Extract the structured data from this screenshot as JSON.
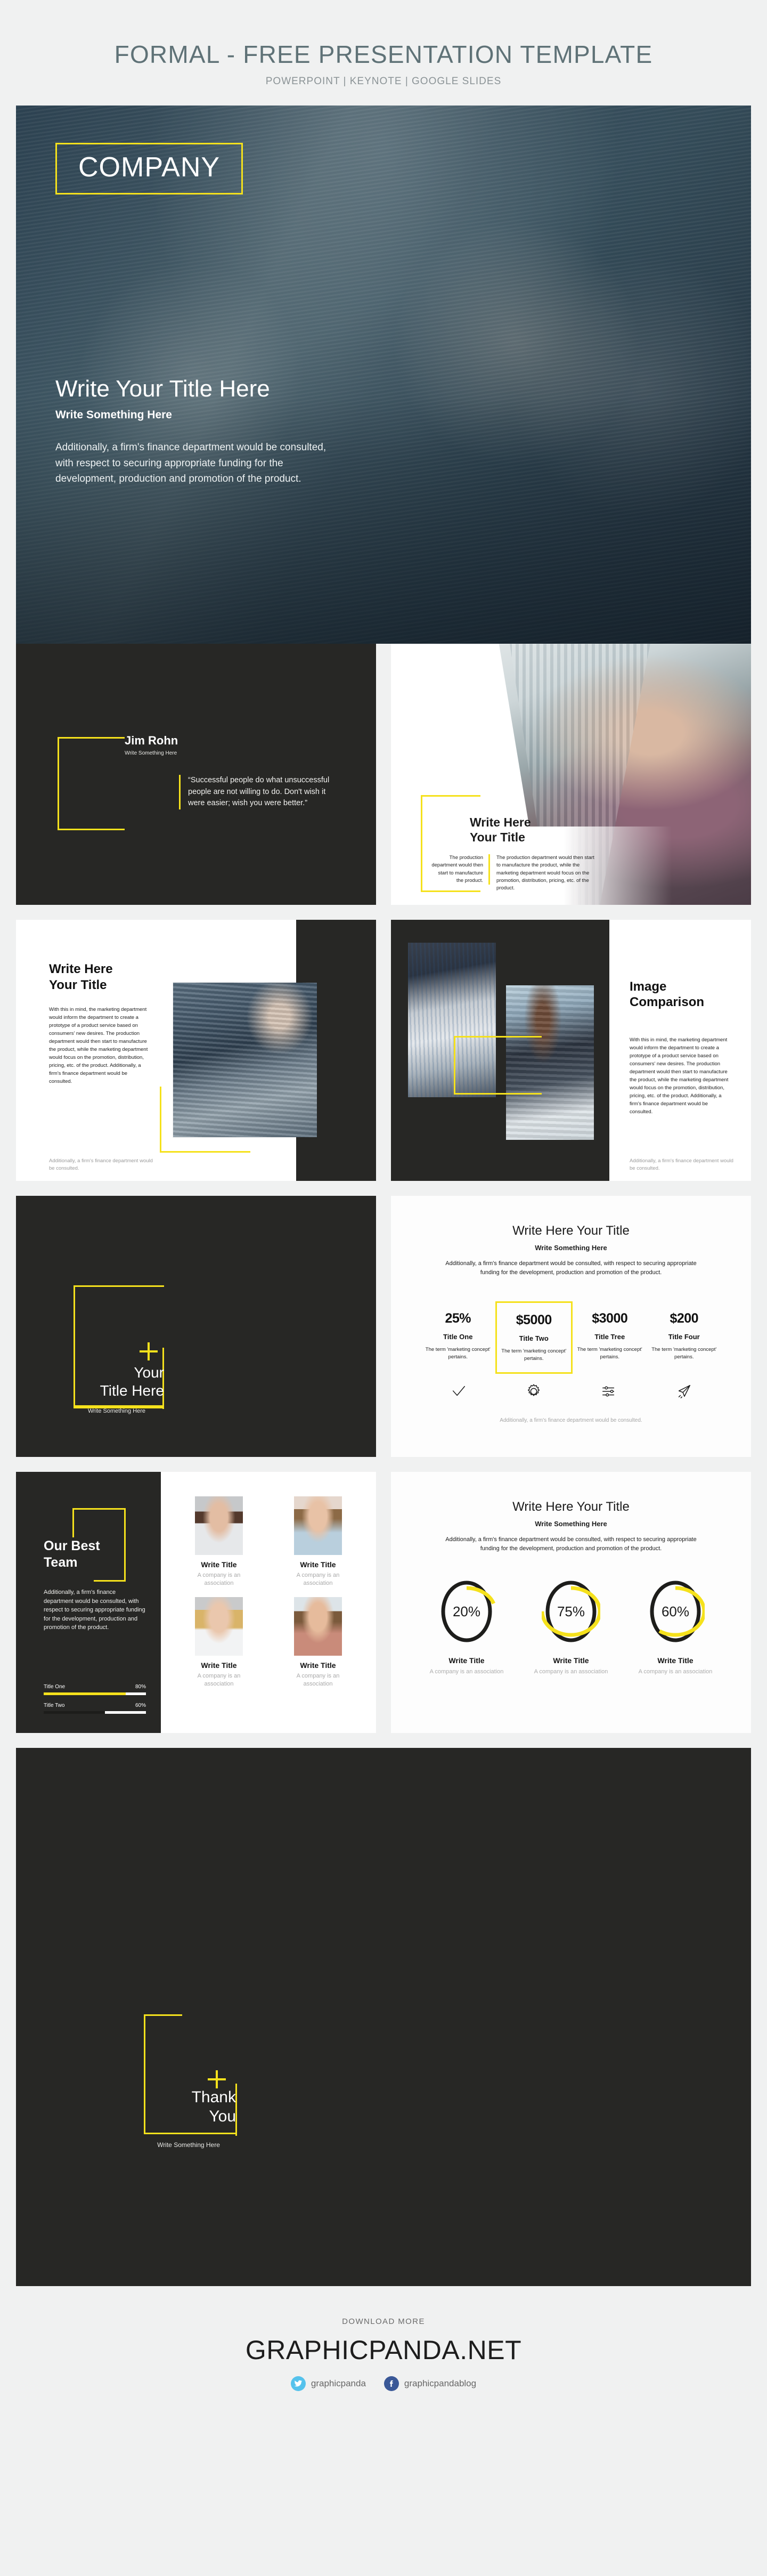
{
  "header": {
    "title": "FORMAL - FREE PRESENTATION TEMPLATE",
    "subtitle": "POWERPOINT | KEYNOTE | GOOGLE SLIDES"
  },
  "colors": {
    "accent_yellow": "#f5e11c",
    "dark": "#272725",
    "page_bg": "#f0f1f1",
    "header_text": "#5f7277",
    "twitter_blue": "#55c2ec",
    "facebook_blue": "#3a5897"
  },
  "hero": {
    "company": "COMPANY",
    "title": "Write Your Title Here",
    "subtitle": "Write Something Here",
    "body": "Additionally, a firm's finance department would be consulted, with respect to securing appropriate funding for the development, production and promotion of the product."
  },
  "quote_slide": {
    "author": "Jim Rohn",
    "author_sub": "Write Something Here",
    "quote": "“Successful people do what unsuccessful people are not willing to do. Don't wish it were easier; wish you were better.”"
  },
  "diagonal_slide": {
    "title_line1": "Write Here",
    "title_line2": "Your Title",
    "col_a": "The production department would then start to manufacture the product.",
    "col_b": "The production department would then start to manufacture the product, while the marketing department would focus on the promotion, distribution, pricing, etc. of the product."
  },
  "text_image_slide": {
    "title_line1": "Write Here",
    "title_line2": "Your Title",
    "paragraph": "With this in mind, the marketing department would inform the department to create a prototype of a product service based on consumers' new desires. The production department would then start to manufacture the product, while the marketing department would focus on the promotion, distribution, pricing, etc. of the product. Additionally, a firm's finance department would be consulted.",
    "footnote": "Additionally, a firm's finance department would be consulted."
  },
  "image_comparison_slide": {
    "title_line1": "Image",
    "title_line2": "Comparison",
    "paragraph": "With this in mind, the marketing department would inform the department to create a prototype of a product service based on consumers' new desires. The production department would then start to manufacture the product, while the marketing department would focus on the promotion, distribution, pricing, etc. of the product. Additionally, a firm's finance department would be consulted.",
    "footnote": "Additionally, a firm's finance department would be consulted."
  },
  "section_title_slide": {
    "title_line1": "Your",
    "title_line2": "Title Here",
    "subtitle": "Write Something Here"
  },
  "stats_slide": {
    "title": "Write Here Your Title",
    "subtitle": "Write Something Here",
    "description": "Additionally, a firm's finance department would be consulted, with respect to securing appropriate funding for the development, production and promotion of the product.",
    "footnote": "Additionally, a firm's finance department would be consulted.",
    "items": [
      {
        "value": "25%",
        "label": "Title One",
        "text": "The term 'marketing concept' pertains.",
        "icon": "check-icon",
        "highlighted": false
      },
      {
        "value": "$5000",
        "label": "Title Two",
        "text": "The term 'marketing concept' pertains.",
        "icon": "gear-icon",
        "highlighted": true
      },
      {
        "value": "$3000",
        "label": "Title Tree",
        "text": "The term 'marketing concept' pertains.",
        "icon": "sliders-icon",
        "highlighted": false
      },
      {
        "value": "$200",
        "label": "Title Four",
        "text": "The term 'marketing concept' pertains.",
        "icon": "paper-plane-icon",
        "highlighted": false
      }
    ]
  },
  "team_slide": {
    "title_line1": "Our Best",
    "title_line2": "Team",
    "paragraph": "Additionally, a firm's finance department would be consulted, with respect to securing appropriate funding for the development, production and promotion of the product.",
    "bars": [
      {
        "label": "Title One",
        "percent": "80%",
        "value": 80,
        "color": "#f5e11c"
      },
      {
        "label": "Title Two",
        "percent": "60%",
        "value": 60,
        "color": "#1d1d1b"
      }
    ],
    "members": [
      {
        "name": "Write Title",
        "role": "A company is an association"
      },
      {
        "name": "Write Title",
        "role": "A company is an association"
      },
      {
        "name": "Write Title",
        "role": "A company is an association"
      },
      {
        "name": "Write Title",
        "role": "A company is an association"
      }
    ]
  },
  "donut_slide": {
    "title": "Write Here Your Title",
    "subtitle": "Write Something Here",
    "description": "Additionally, a firm's finance department would be consulted, with respect to securing appropriate funding for the development, production and promotion of the product.",
    "items": [
      {
        "percent": "20%",
        "value": 20,
        "name": "Write Title",
        "sub": "A company is an association"
      },
      {
        "percent": "75%",
        "value": 75,
        "name": "Write Title",
        "sub": "A company is an association"
      },
      {
        "percent": "60%",
        "value": 60,
        "name": "Write Title",
        "sub": "A company is an association"
      }
    ]
  },
  "thank_you_slide": {
    "title_line1": "Thank",
    "title_line2": "You",
    "subtitle": "Write Something Here"
  },
  "footer": {
    "kicker": "DOWNLOAD MORE",
    "brand": "GRAPHICPANDA.NET",
    "twitter_handle": "graphicpanda",
    "facebook_handle": "graphicpandablog"
  },
  "chart_data": [
    {
      "type": "bar",
      "title": "Our Best Team skill bars",
      "categories": [
        "Title One",
        "Title Two"
      ],
      "values": [
        80,
        60
      ],
      "xlabel": "",
      "ylabel": "",
      "ylim": [
        0,
        100
      ],
      "colors": [
        "#f5e11c",
        "#1d1d1b"
      ],
      "orientation": "horizontal",
      "grid": false,
      "legend": "none"
    },
    {
      "type": "pie",
      "title": "Write Here Your Title",
      "subtitle": "Write Something Here",
      "categories": [
        "Write Title",
        "Write Title",
        "Write Title"
      ],
      "values": [
        20,
        75,
        60
      ],
      "labels": [
        "20%",
        "75%",
        "60%"
      ],
      "ring": true,
      "track_color": "#1d1d1b",
      "fill_color": "#f5e11c",
      "ylim": [
        0,
        100
      ],
      "grid": false,
      "legend": "below"
    }
  ]
}
